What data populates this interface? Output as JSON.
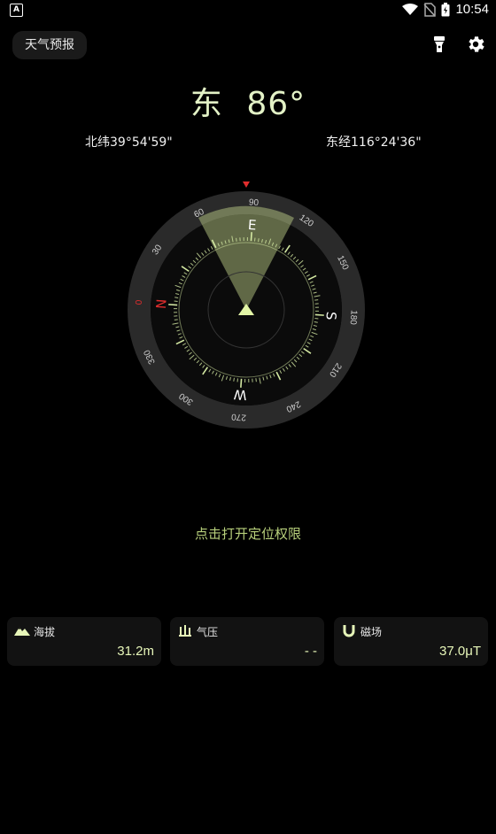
{
  "status_bar": {
    "time": "10:54",
    "battery_label": "B",
    "notification_letter": "A"
  },
  "header": {
    "weather_button": "天气预报",
    "flashlight_icon": "flashlight-icon",
    "settings_icon": "gear-icon"
  },
  "heading": {
    "direction": "东",
    "degrees": "86°"
  },
  "coords": {
    "latitude": "北纬39°54'59\"",
    "longitude": "东经116°24'36\""
  },
  "compass": {
    "cardinals": [
      "E",
      "S",
      "W",
      "N"
    ],
    "degree_labels": [
      "90",
      "120",
      "150",
      "180",
      "210",
      "240",
      "270",
      "300",
      "330",
      "0",
      "30",
      "60"
    ],
    "heading_value": 86,
    "colors": {
      "accent": "#d3e8a2",
      "north": "#e12d2d",
      "ring": "#2a2a2a"
    }
  },
  "prompt": "点击打开定位权限",
  "cards": [
    {
      "label": "海拔",
      "value": "31.2m",
      "icon": "mountain-icon"
    },
    {
      "label": "气压",
      "value": "- -",
      "icon": "pressure-icon"
    },
    {
      "label": "磁场",
      "value": "37.0μT",
      "icon": "magnet-icon"
    }
  ]
}
